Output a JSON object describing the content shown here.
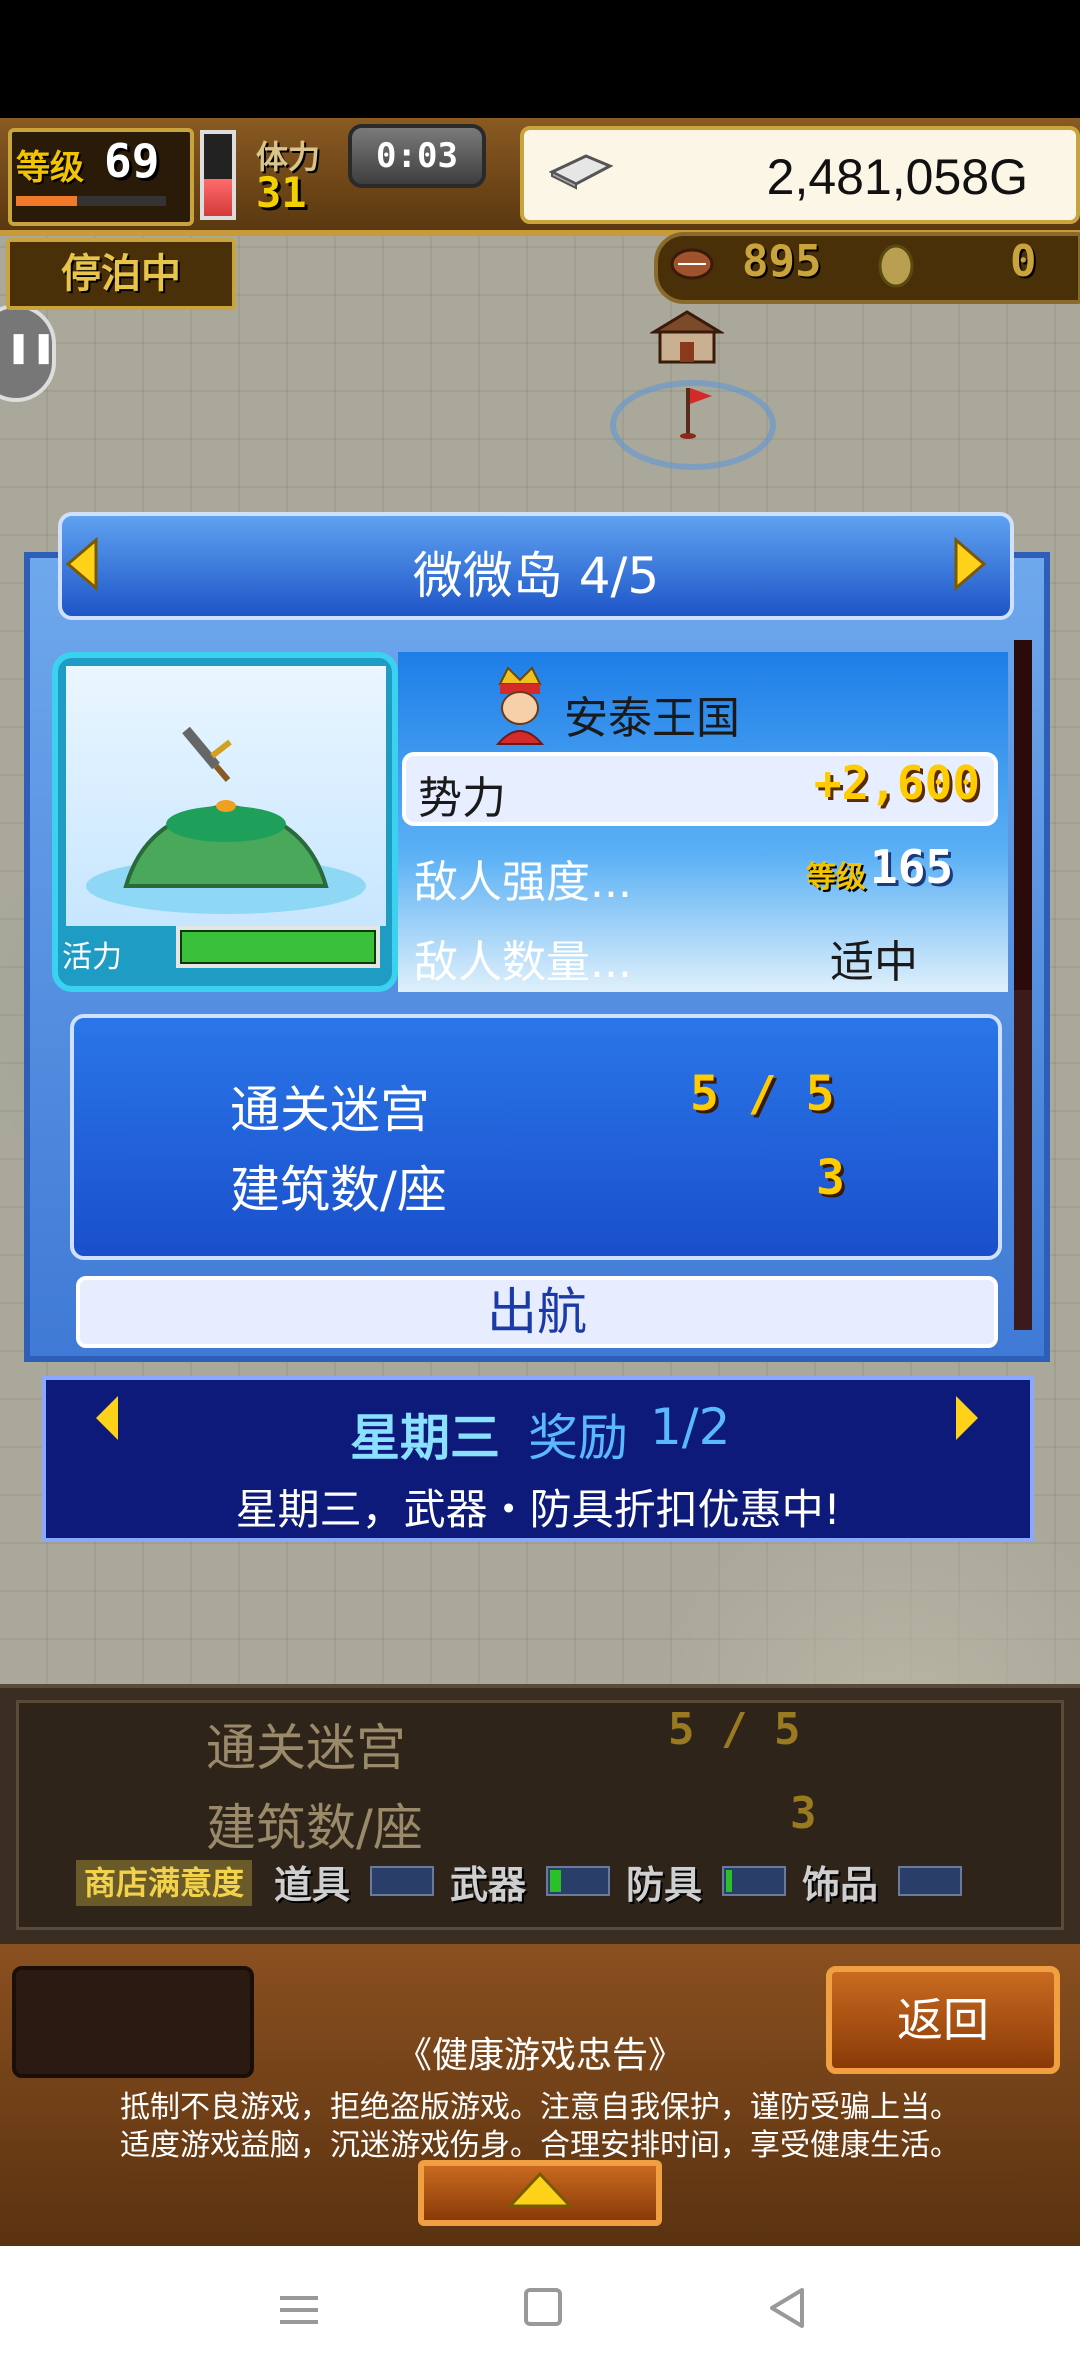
{
  "hud": {
    "level_label": "等级",
    "level_value": "69",
    "level_progress": 0.41,
    "stamina_label": "体力",
    "stamina_value": "31",
    "stamina_gauge_level": 0.45,
    "timer": "0:03",
    "gold": "2,481,058G"
  },
  "status": {
    "docked_label": "停泊中",
    "counter1": "895",
    "counter2": "0"
  },
  "island_dialog": {
    "title": "微微岛 4/5",
    "vitality_label": "活力",
    "vitality_level": 1.0,
    "kingdom": "安泰王国",
    "power_label": "势力",
    "power_value": "+2,600",
    "enemy_strength_label": "敌人强度...",
    "enemy_level_tag": "等级",
    "enemy_level_value": "165",
    "enemy_count_label": "敌人数量...",
    "enemy_count_value": "适中",
    "stats": [
      {
        "label": "通关迷宫",
        "value": "5 / 5"
      },
      {
        "label": "建筑数/座",
        "value": "3"
      }
    ],
    "sail_button": "出航"
  },
  "bonus_banner": {
    "day": "星期三",
    "title": "奖励",
    "page": "1/2",
    "message": "星期三，武器・防具折扣优惠中!"
  },
  "shop_panel": {
    "stats": [
      {
        "label": "通关迷宫",
        "value": "5 / 5"
      },
      {
        "label": "建筑数/座",
        "value": "3"
      }
    ],
    "satisfaction_label": "商店满意度",
    "categories": [
      {
        "label": "道具",
        "level": 0.0
      },
      {
        "label": "武器",
        "level": 0.2
      },
      {
        "label": "防具",
        "level": 0.1
      },
      {
        "label": "饰品",
        "level": 0.0
      }
    ]
  },
  "footer": {
    "back_button": "返回",
    "health_title": "《健康游戏忠告》",
    "health_line1": "抵制不良游戏，拒绝盗版游戏。注意自我保护，谨防受骗上当。",
    "health_line2": "适度游戏益脑，沉迷游戏伤身。合理安排时间，享受健康生活。"
  },
  "colors": {
    "gold_text": "#ffcc00",
    "vitality_fill": "#3ac03a",
    "dialog_blue": "#1e55c8",
    "bonus_bg": "#0d1a7a"
  }
}
